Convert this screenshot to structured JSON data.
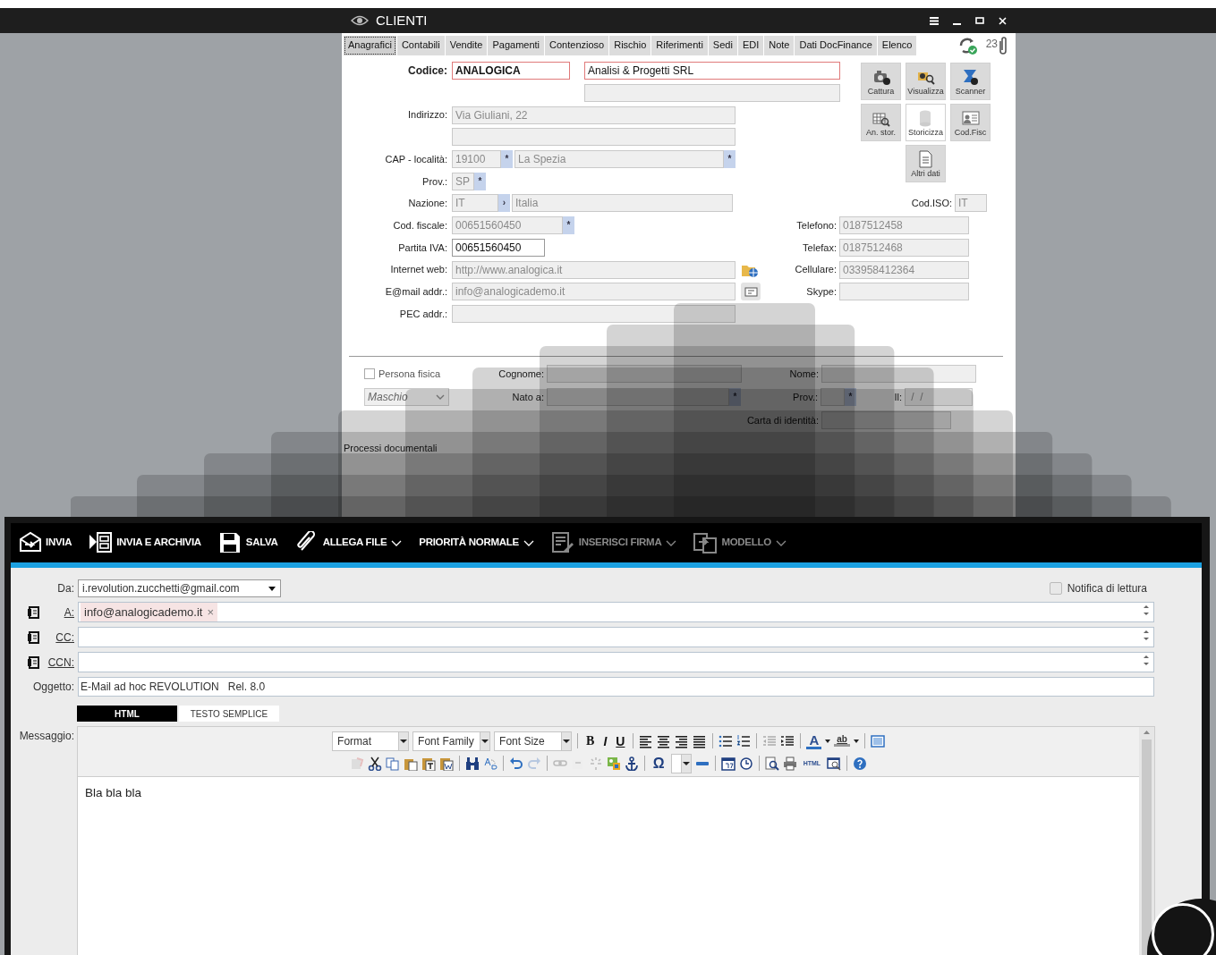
{
  "clienti_window": {
    "title": "CLIENTI",
    "tabs": [
      {
        "label": "Anagrafici",
        "selected": true
      },
      {
        "label": "Contabili",
        "selected": false
      },
      {
        "label": "Vendite",
        "selected": false
      },
      {
        "label": "Pagamenti",
        "selected": false
      },
      {
        "label": "Contenzioso",
        "selected": false
      },
      {
        "label": "Rischio",
        "selected": false
      },
      {
        "label": "Riferimenti",
        "selected": false
      },
      {
        "label": "Sedi",
        "selected": false
      },
      {
        "label": "EDI",
        "selected": false
      },
      {
        "label": "Note",
        "selected": false
      },
      {
        "label": "Dati DocFinance",
        "selected": false
      },
      {
        "label": "Elenco",
        "selected": false
      }
    ],
    "attachment_count": "23",
    "form_rows": [
      {
        "label": "Codice:",
        "fields": [
          {
            "value": "ANALOGICA",
            "kind": "required"
          },
          {
            "value": "Analisi & Progetti SRL",
            "kind": "required"
          }
        ]
      },
      {
        "fields": [
          {
            "kind": "readonly"
          }
        ]
      },
      {
        "label": "Indirizzo:",
        "fields": [
          {
            "value": "Via Giuliani, 22",
            "kind": "readonly"
          }
        ]
      },
      {
        "fields": [
          {
            "kind": "readonly"
          }
        ]
      },
      {
        "label": "CAP - località:",
        "fields": [
          {
            "value": "19100",
            "kind": "readonly",
            "button": "*"
          },
          {
            "value": "La Spezia",
            "kind": "readonly",
            "button": "*"
          }
        ]
      },
      {
        "label": "Prov.:",
        "fields": [
          {
            "value": "SP",
            "kind": "readonly",
            "button": "*"
          }
        ]
      },
      {
        "label": "Nazione:",
        "fields": [
          {
            "value": "IT",
            "kind": "readonly",
            "button": "›"
          },
          {
            "value": "Italia",
            "kind": "readonly"
          }
        ],
        "right": {
          "label": "Cod.ISO:",
          "value": "IT"
        }
      },
      {
        "label": "Cod. fiscale:",
        "fields": [
          {
            "value": "00651560450",
            "kind": "readonly",
            "button": "*"
          }
        ],
        "right": {
          "label": "Telefono:",
          "value": "0187512458"
        }
      },
      {
        "label": "Partita IVA:",
        "fields": [
          {
            "value": "00651560450",
            "kind": "editable"
          }
        ],
        "right": {
          "label": "Telefax:",
          "value": "0187512468"
        }
      },
      {
        "label": "Internet web:",
        "fields": [
          {
            "value": "http://www.analogica.it",
            "kind": "readonly"
          }
        ],
        "right": {
          "label": "Cellulare:",
          "value": "033958412364"
        }
      },
      {
        "label": "E@mail addr.:",
        "fields": [
          {
            "value": "info@analogicademo.it",
            "kind": "readonly"
          }
        ],
        "right": {
          "label": "Skype:"
        }
      },
      {
        "label": "PEC addr.:",
        "fields": [
          {
            "kind": "readonly"
          }
        ]
      }
    ],
    "side_buttons": [
      {
        "label": "Cattura",
        "disabled": false
      },
      {
        "label": "Visualizza",
        "disabled": false
      },
      {
        "label": "Scanner",
        "disabled": false
      },
      {
        "label": "An. stor.",
        "disabled": false
      },
      {
        "label": "Storicizza",
        "disabled": true
      },
      {
        "label": "Cod.Fisc",
        "disabled": false
      },
      {
        "label": "Altri dati",
        "disabled": false
      }
    ],
    "persona_fisica": {
      "label": "Persona fisica",
      "checked": false
    },
    "sesso": "Maschio",
    "cognome_label": "Cognome:",
    "nome_label": "Nome:",
    "nato_label": "Nato a:",
    "nato_button": "*",
    "prov_label": "Prov.:",
    "prov_button": "*",
    "il_label": "Il:",
    "il_value": " /  /",
    "carta_label": "Carta di identità:",
    "processi_label": "Processi documentali"
  },
  "email_window": {
    "toolbar": [
      {
        "label": "INVIA",
        "dropdown": false,
        "disabled": false
      },
      {
        "label": "INVIA E ARCHIVIA",
        "dropdown": false,
        "disabled": false
      },
      {
        "label": "SALVA",
        "dropdown": false,
        "disabled": false
      },
      {
        "label": "ALLEGA FILE",
        "dropdown": true,
        "disabled": false
      },
      {
        "label": "PRIORITÀ NORMALE",
        "dropdown": true,
        "disabled": false
      },
      {
        "label": "INSERISCI FIRMA",
        "dropdown": true,
        "disabled": true
      },
      {
        "label": "MODELLO",
        "dropdown": true,
        "disabled": true
      }
    ],
    "from_label": "Da:",
    "from_value": "i.revolution.zucchetti@gmail.com",
    "read_receipt": {
      "label": "Notifica di lettura",
      "checked": false
    },
    "recipients": [
      {
        "label": "A:",
        "tags": [
          {
            "text": "info@analogicademo.it",
            "remove": "×"
          }
        ]
      },
      {
        "label": "CC:"
      },
      {
        "label": "CCN:"
      }
    ],
    "subject_label": "Oggetto:",
    "subject": "E-Mail ad hoc REVOLUTION   Rel. 8.0",
    "format_tabs": [
      {
        "label": "HTML",
        "selected": true
      },
      {
        "label": "TESTO SEMPLICE",
        "selected": false
      }
    ],
    "message_label": "Messaggio:",
    "editor": {
      "selects": [
        "Format",
        "Font Family",
        "Font Size"
      ],
      "glyphs": [
        "B",
        "I",
        "U",
        "A",
        "ab",
        "Ω",
        "HTML"
      ],
      "body": "Bla bla bla"
    }
  }
}
